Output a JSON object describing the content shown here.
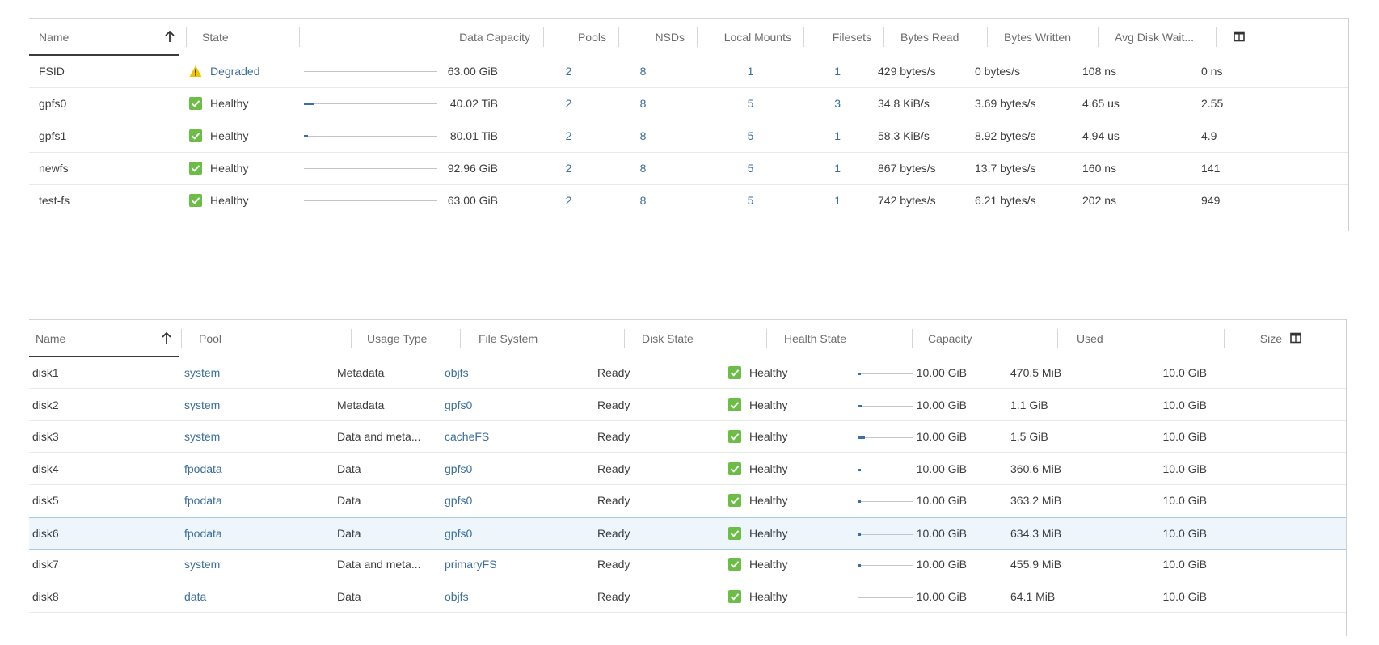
{
  "fs_table": {
    "columns": {
      "name": "Name",
      "state": "State",
      "data_capacity": "Data Capacity",
      "pools": "Pools",
      "nsds": "NSDs",
      "local_mounts": "Local Mounts",
      "filesets": "Filesets",
      "bytes_read": "Bytes Read",
      "bytes_written": "Bytes Written",
      "avg_disk_wait": "Avg Disk Wait..."
    },
    "rows": [
      {
        "name": "FSID",
        "state": "Degraded",
        "state_icon": "warning-icon",
        "usage_fraction": 0.0,
        "capacity": "63.00 GiB",
        "pools": "2",
        "nsds": "8",
        "local_mounts": "1",
        "filesets": "1",
        "bytes_read": "429 bytes/s",
        "bytes_written": "0 bytes/s",
        "avg_disk_wait": "108 ns",
        "next": "0 ns"
      },
      {
        "name": "gpfs0",
        "state": "Healthy",
        "state_icon": "check-icon",
        "usage_fraction": 0.04,
        "capacity": "40.02 TiB",
        "pools": "2",
        "nsds": "8",
        "local_mounts": "5",
        "filesets": "3",
        "bytes_read": "34.8 KiB/s",
        "bytes_written": "3.69 bytes/s",
        "avg_disk_wait": "4.65 us",
        "next": "2.55"
      },
      {
        "name": "gpfs1",
        "state": "Healthy",
        "state_icon": "check-icon",
        "usage_fraction": 0.015,
        "capacity": "80.01 TiB",
        "pools": "2",
        "nsds": "8",
        "local_mounts": "5",
        "filesets": "1",
        "bytes_read": "58.3 KiB/s",
        "bytes_written": "8.92 bytes/s",
        "avg_disk_wait": "4.94 us",
        "next": "4.9"
      },
      {
        "name": "newfs",
        "state": "Healthy",
        "state_icon": "check-icon",
        "usage_fraction": 0.0,
        "capacity": "92.96 GiB",
        "pools": "2",
        "nsds": "8",
        "local_mounts": "5",
        "filesets": "1",
        "bytes_read": "867 bytes/s",
        "bytes_written": "13.7 bytes/s",
        "avg_disk_wait": "160 ns",
        "next": "141"
      },
      {
        "name": "test-fs",
        "state": "Healthy",
        "state_icon": "check-icon",
        "usage_fraction": 0.0,
        "capacity": "63.00 GiB",
        "pools": "2",
        "nsds": "8",
        "local_mounts": "5",
        "filesets": "1",
        "bytes_read": "742 bytes/s",
        "bytes_written": "6.21 bytes/s",
        "avg_disk_wait": "202 ns",
        "next": "949"
      }
    ]
  },
  "nsd_table": {
    "columns": {
      "name": "Name",
      "pool": "Pool",
      "usage_type": "Usage Type",
      "file_system": "File System",
      "disk_state": "Disk State",
      "health_state": "Health State",
      "capacity": "Capacity",
      "used": "Used",
      "size": "Size"
    },
    "rows": [
      {
        "name": "disk1",
        "pool": "system",
        "usage_type": "Metadata",
        "file_system": "objfs",
        "disk_state": "Ready",
        "health": "Healthy",
        "usage_fraction": 0.03,
        "capacity": "10.00 GiB",
        "used": "470.5 MiB",
        "size": "10.0 GiB",
        "selected": false
      },
      {
        "name": "disk2",
        "pool": "system",
        "usage_type": "Metadata",
        "file_system": "gpfs0",
        "disk_state": "Ready",
        "health": "Healthy",
        "usage_fraction": 0.08,
        "capacity": "10.00 GiB",
        "used": "1.1 GiB",
        "size": "10.0 GiB",
        "selected": false
      },
      {
        "name": "disk3",
        "pool": "system",
        "usage_type": "Data and meta...",
        "file_system": "cacheFS",
        "disk_state": "Ready",
        "health": "Healthy",
        "usage_fraction": 0.12,
        "capacity": "10.00 GiB",
        "used": "1.5 GiB",
        "size": "10.0 GiB",
        "selected": false
      },
      {
        "name": "disk4",
        "pool": "fpodata",
        "usage_type": "Data",
        "file_system": "gpfs0",
        "disk_state": "Ready",
        "health": "Healthy",
        "usage_fraction": 0.02,
        "capacity": "10.00 GiB",
        "used": "360.6 MiB",
        "size": "10.0 GiB",
        "selected": false
      },
      {
        "name": "disk5",
        "pool": "fpodata",
        "usage_type": "Data",
        "file_system": "gpfs0",
        "disk_state": "Ready",
        "health": "Healthy",
        "usage_fraction": 0.02,
        "capacity": "10.00 GiB",
        "used": "363.2 MiB",
        "size": "10.0 GiB",
        "selected": false
      },
      {
        "name": "disk6",
        "pool": "fpodata",
        "usage_type": "Data",
        "file_system": "gpfs0",
        "disk_state": "Ready",
        "health": "Healthy",
        "usage_fraction": 0.04,
        "capacity": "10.00 GiB",
        "used": "634.3 MiB",
        "size": "10.0 GiB",
        "selected": true
      },
      {
        "name": "disk7",
        "pool": "system",
        "usage_type": "Data and meta...",
        "file_system": "primaryFS",
        "disk_state": "Ready",
        "health": "Healthy",
        "usage_fraction": 0.03,
        "capacity": "10.00 GiB",
        "used": "455.9 MiB",
        "size": "10.0 GiB",
        "selected": false
      },
      {
        "name": "disk8",
        "pool": "data",
        "usage_type": "Data",
        "file_system": "objfs",
        "disk_state": "Ready",
        "health": "Healthy",
        "usage_fraction": 0.0,
        "capacity": "10.00 GiB",
        "used": "64.1 MiB",
        "size": "10.0 GiB",
        "selected": false
      }
    ]
  },
  "colors": {
    "accent": "#3b6fa8",
    "link": "#3b6e9c",
    "healthy": "#6bbd45",
    "warning": "#f2c200",
    "selected_row": "#eef6fc"
  }
}
